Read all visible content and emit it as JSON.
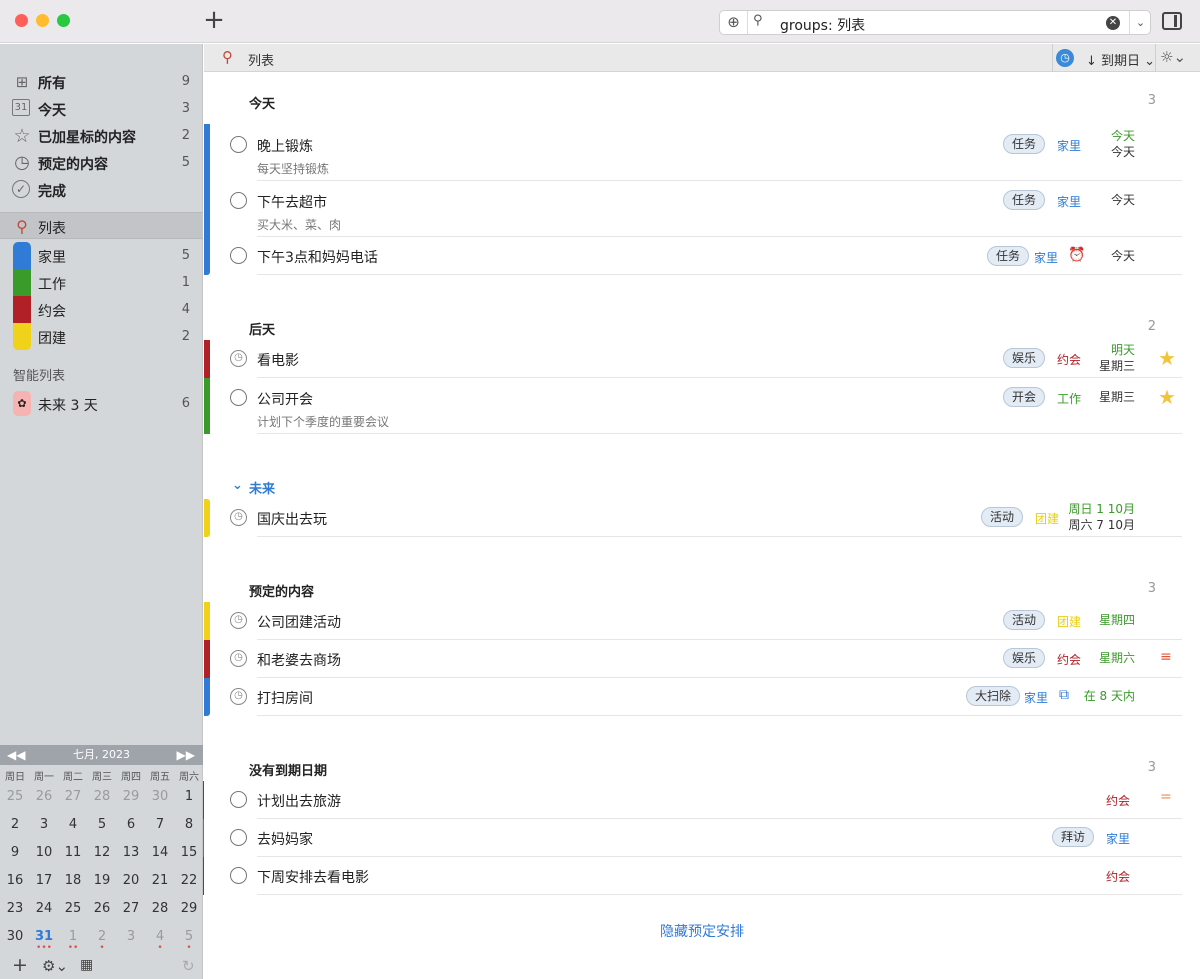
{
  "titlebar": {
    "add_label": "+"
  },
  "search": {
    "value": "groups: 列表"
  },
  "sidebar": {
    "items": [
      {
        "label": "所有",
        "count": "9",
        "icon": "grid-icon",
        "glyph": "⊞"
      },
      {
        "label": "今天",
        "count": "3",
        "icon": "calendar-icon",
        "glyph": "31"
      },
      {
        "label": "已加星标的内容",
        "count": "2",
        "icon": "star-outline-icon",
        "glyph": "☆"
      },
      {
        "label": "预定的内容",
        "count": "5",
        "icon": "clock-icon",
        "glyph": "◷"
      },
      {
        "label": "完成",
        "count": "",
        "icon": "check-circle-icon",
        "glyph": "✓"
      }
    ],
    "lists_header": "列表",
    "lists": [
      {
        "label": "家里",
        "count": "5",
        "color": "#2f7bd6"
      },
      {
        "label": "工作",
        "count": "1",
        "color": "#3a9a2a"
      },
      {
        "label": "约会",
        "count": "4",
        "color": "#b02026"
      },
      {
        "label": "团建",
        "count": "2",
        "color": "#f0d21a"
      }
    ],
    "smart_header": "智能列表",
    "smart": [
      {
        "label": "未来 3 天",
        "count": "6",
        "color": "#f7b2b2"
      }
    ]
  },
  "calendar": {
    "month": "七月, 2023",
    "weekdays": [
      "周日",
      "周一",
      "周二",
      "周三",
      "周四",
      "周五",
      "周六"
    ],
    "weeks": [
      [
        "25",
        "26",
        "27",
        "28",
        "29",
        "30",
        "1"
      ],
      [
        "2",
        "3",
        "4",
        "5",
        "6",
        "7",
        "8"
      ],
      [
        "9",
        "10",
        "11",
        "12",
        "13",
        "14",
        "15"
      ],
      [
        "16",
        "17",
        "18",
        "19",
        "20",
        "21",
        "22"
      ],
      [
        "23",
        "24",
        "25",
        "26",
        "27",
        "28",
        "29"
      ],
      [
        "30",
        "31",
        "1",
        "2",
        "3",
        "4",
        "5"
      ]
    ]
  },
  "listbar": {
    "title": "列表",
    "sort_label": "到期日"
  },
  "groups": [
    {
      "title": "今天",
      "count": "3"
    },
    {
      "title": "后天",
      "count": "2"
    },
    {
      "title": "未来",
      "count": ""
    },
    {
      "title": "预定的内容",
      "count": "3"
    },
    {
      "title": "没有到期日期",
      "count": "3"
    }
  ],
  "tasks": [
    {
      "title": "晚上锻炼",
      "note": "每天坚持锻炼",
      "tag": "任务",
      "list": "家里",
      "due1": "今天",
      "due2": "今天"
    },
    {
      "title": "下午去超市",
      "note": "买大米、菜、肉",
      "tag": "任务",
      "list": "家里",
      "due1": "今天",
      "due2": ""
    },
    {
      "title": "下午3点和妈妈电话",
      "note": "",
      "tag": "任务",
      "list": "家里",
      "due1": "今天",
      "due2": ""
    },
    {
      "title": "看电影",
      "note": "",
      "tag": "娱乐",
      "list": "约会",
      "due1": "明天",
      "due2": "星期三"
    },
    {
      "title": "公司开会",
      "note": "计划下个季度的重要会议",
      "tag": "开会",
      "list": "工作",
      "due1": "星期三",
      "due2": ""
    },
    {
      "title": "国庆出去玩",
      "note": "",
      "tag": "活动",
      "list": "团建",
      "due1": "周日 1 10月",
      "due2": "周六 7 10月"
    },
    {
      "title": "公司团建活动",
      "note": "",
      "tag": "活动",
      "list": "团建",
      "due1": "星期四",
      "due2": ""
    },
    {
      "title": "和老婆去商场",
      "note": "",
      "tag": "娱乐",
      "list": "约会",
      "due1": "星期六",
      "due2": ""
    },
    {
      "title": "打扫房间",
      "note": "",
      "tag": "大扫除",
      "list": "家里",
      "due1": "在 8 天内",
      "due2": ""
    },
    {
      "title": "计划出去旅游",
      "note": "",
      "tag": "",
      "list": "约会",
      "due1": "",
      "due2": ""
    },
    {
      "title": "去妈妈家",
      "note": "",
      "tag": "拜访",
      "list": "家里",
      "due1": "",
      "due2": ""
    },
    {
      "title": "下周安排去看电影",
      "note": "",
      "tag": "",
      "list": "约会",
      "due1": "",
      "due2": ""
    }
  ],
  "hide_scheduled": "隐藏预定安排",
  "colors": {
    "home": "#2f7bd6",
    "work": "#3a9a2a",
    "date": "#b02026",
    "team": "#f0d21a",
    "accent": "#2f7bd6",
    "due_green": "#3a9a2a"
  }
}
